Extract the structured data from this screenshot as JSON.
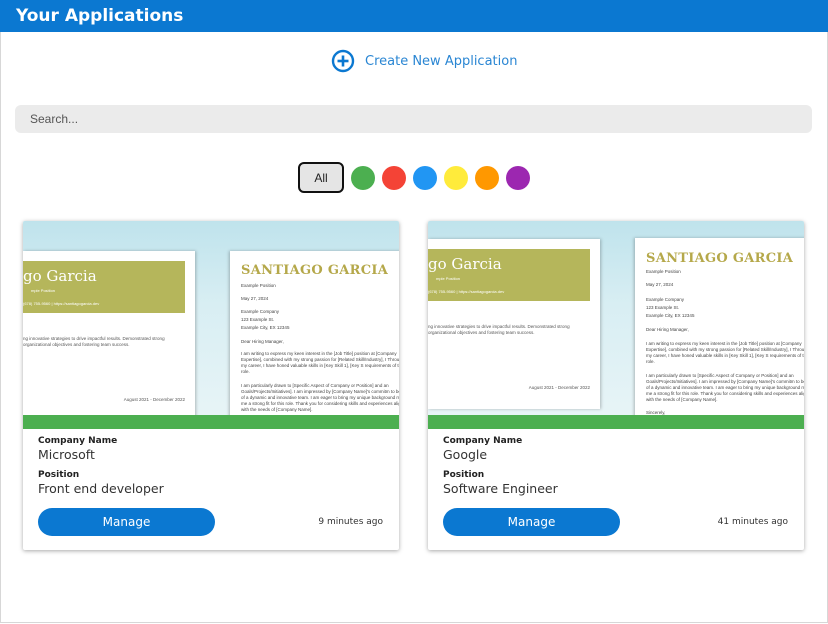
{
  "header": {
    "title": "Your Applications"
  },
  "create": {
    "label": "Create New Application"
  },
  "search": {
    "placeholder": "Search..."
  },
  "filters": {
    "all_label": "All",
    "colors": [
      "#4caf50",
      "#f44336",
      "#2196f3",
      "#ffeb3b",
      "#ff9800",
      "#9c27b0"
    ]
  },
  "labels": {
    "company": "Company Name",
    "position": "Position",
    "manage": "Manage"
  },
  "resume": {
    "name_partial": "go Garcia",
    "name_full": "SANTIAGO GARCIA",
    "sub": "mple Position",
    "contact": "(678) 755-9560   |   https://santiagogarcia.dev",
    "summary": "ng innovative strategies to drive impactful results. Demonstrated strong organizational objectives and fostering team success.",
    "dates": "August 2021 - December 2022",
    "position": "Example Position",
    "date": "May 27, 2024",
    "company": "Example Company",
    "street": "123 Example St.",
    "city": "Example City, EX 12345",
    "greeting": "Dear Hiring Manager,",
    "para1": "I am writing to express my keen interest in the [Job Title] position at [Company Expertise], combined with my strong passion for [Related Skill/Industry], I Throughout my career, I have honed valuable skills in [Key Skill 1], [Key S requirements of the role.",
    "para2": "I am particularly drawn to [Specific Aspect of Company or Position] and an Goals/Projects/Initiatives]. I am impressed by [Company Name]'s commitm to be part of a dynamic and innovative team. I am eager to bring my unique background makes me a strong fit for this role. Thank you for considering skills and experiences align with the needs of [Company Name].",
    "closing": "Sincerely,"
  },
  "applications": [
    {
      "company": "Microsoft",
      "position": "Front end developer",
      "time": "9 minutes ago"
    },
    {
      "company": "Google",
      "position": "Software Engineer",
      "time": "41 minutes ago"
    }
  ]
}
